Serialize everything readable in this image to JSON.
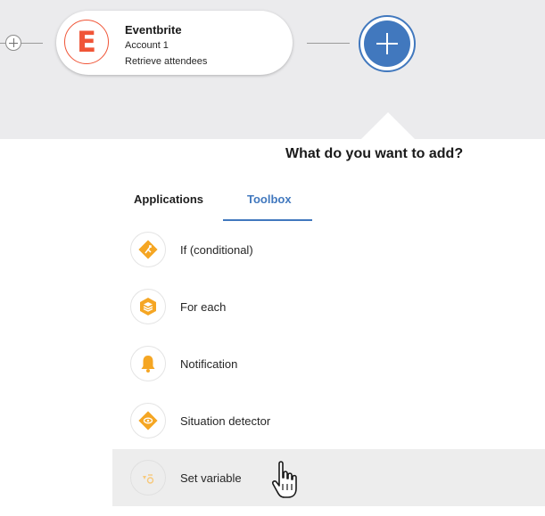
{
  "node": {
    "app_name": "Eventbrite",
    "account": "Account 1",
    "action": "Retrieve attendees",
    "logo_letter": "E",
    "logo_color": "#f05537"
  },
  "add_button": {
    "icon": "plus-icon",
    "accent": "#4178be"
  },
  "panel": {
    "heading": "What do you want to add?",
    "tabs": [
      {
        "label": "Applications",
        "selected": false
      },
      {
        "label": "Toolbox",
        "selected": true
      }
    ]
  },
  "toolbox": {
    "icon_color": "#f5a623",
    "items": [
      {
        "label": "If (conditional)",
        "icon": "branch-diamond-icon"
      },
      {
        "label": "For each",
        "icon": "layers-hexagon-icon"
      },
      {
        "label": "Notification",
        "icon": "bell-icon"
      },
      {
        "label": "Situation detector",
        "icon": "eye-diamond-icon"
      },
      {
        "label": "Set variable",
        "icon": "variable-icon",
        "hovered": true
      }
    ]
  },
  "cursor": {
    "icon": "hand-pointer-icon"
  }
}
